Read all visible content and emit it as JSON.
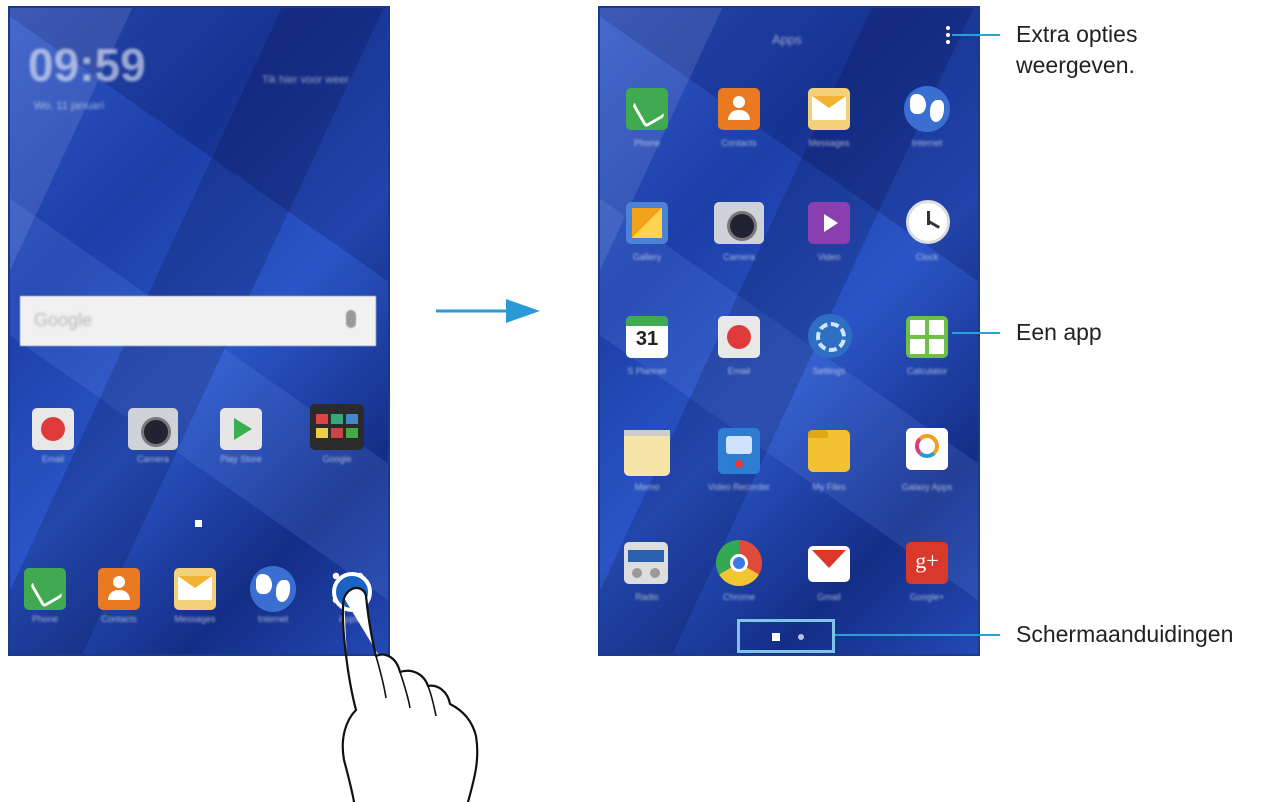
{
  "home_screen": {
    "clock": "09:59",
    "date": "Wo, 11 januari",
    "weather": "Tik hier voor weer",
    "search_placeholder": "Google",
    "apps": [
      "Email",
      "Camera",
      "Play Store",
      "Google"
    ],
    "dock": [
      "Phone",
      "Contacts",
      "Messages",
      "Internet",
      "Apps"
    ]
  },
  "apps_screen": {
    "title": "Apps",
    "apps": [
      "Phone",
      "Contacts",
      "Messages",
      "Internet",
      "Gallery",
      "Camera",
      "Video",
      "Clock",
      "S Planner",
      "Email",
      "Settings",
      "Calculator",
      "Memo",
      "Video Recorder",
      "My Files",
      "Galaxy Apps",
      "Radio",
      "Chrome",
      "Gmail",
      "Google+"
    ],
    "calendar_day": "31"
  },
  "callouts": {
    "more_options_line1": "Extra opties",
    "more_options_line2": "weergeven.",
    "one_app": "Een app",
    "indicators": "Schermaanduidingen"
  }
}
